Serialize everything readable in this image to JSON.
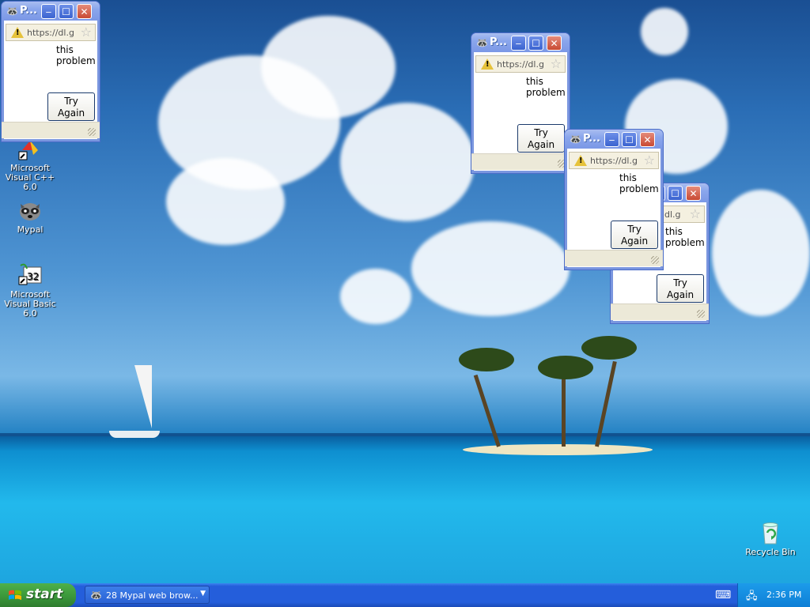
{
  "desktop": {
    "icons": [
      {
        "label": "Microsoft Visual C++ 6.0",
        "icon": "visual-cpp-icon"
      },
      {
        "label": "Mypal",
        "icon": "mypal-raccoon-icon"
      },
      {
        "label": "Microsoft Visual Basic 6.0",
        "icon": "visual-basic-icon"
      },
      {
        "label": "Recycle Bin",
        "icon": "recycle-bin-icon"
      }
    ]
  },
  "popup": {
    "title": "P...",
    "url": "https://dl.g",
    "message": "this problem",
    "button_label": "Try Again"
  },
  "popup_partial_url": "dl.g",
  "taskbar": {
    "start_label": "start",
    "task_label": "28 Mypal web brow...",
    "clock": "2:36 PM"
  },
  "colors": {
    "taskbar_blue": "#245edb",
    "start_green": "#3c9a3c",
    "title_blue": "#8aa6ec",
    "tray_blue": "#0f7fd6"
  }
}
